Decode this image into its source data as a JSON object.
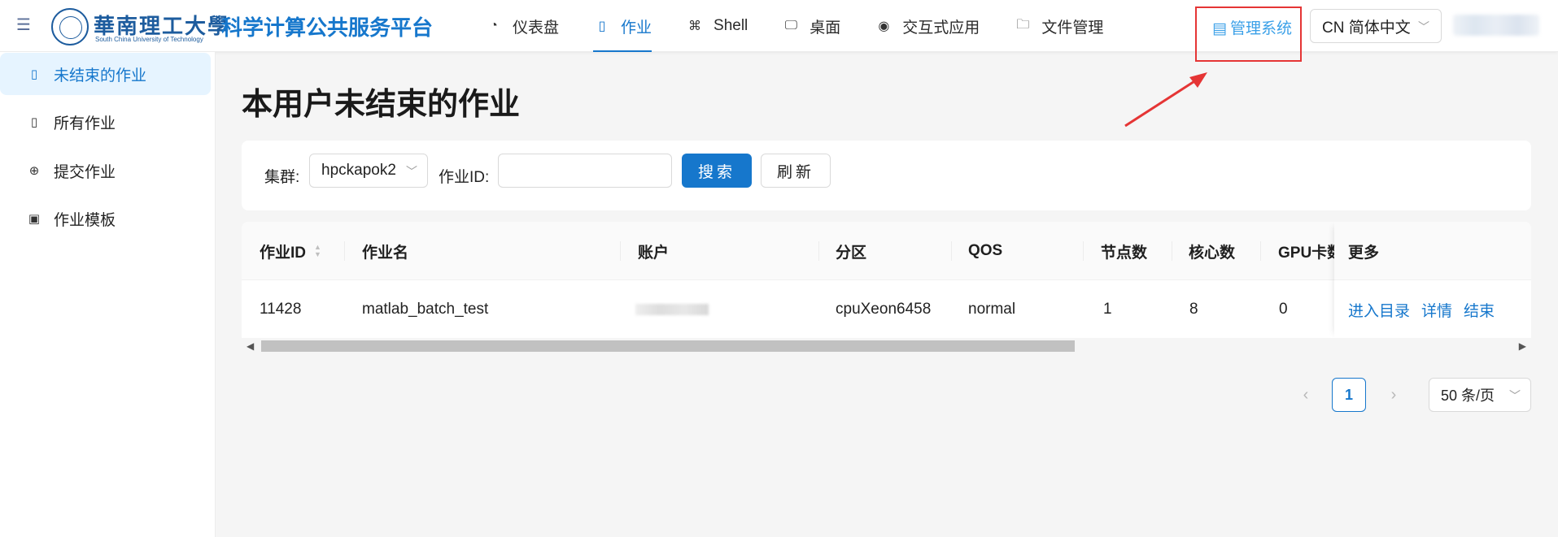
{
  "header": {
    "logo_cn": "華南理工大學",
    "logo_en": "South China University of Technology",
    "app_title": "科学计算公共服务平台",
    "nav": [
      {
        "icon": "dashboard-icon",
        "label": "仪表盘",
        "active": false
      },
      {
        "icon": "book-icon",
        "label": "作业",
        "active": true
      },
      {
        "icon": "shell-icon",
        "label": "Shell",
        "active": false
      },
      {
        "icon": "desktop-icon",
        "label": "桌面",
        "active": false
      },
      {
        "icon": "eye-icon",
        "label": "交互式应用",
        "active": false
      },
      {
        "icon": "folder-icon",
        "label": "文件管理",
        "active": false
      }
    ],
    "admin_link": "管理系统",
    "language": "CN 简体中文"
  },
  "sidebar": {
    "items": [
      {
        "icon": "book-icon",
        "label": "未结束的作业",
        "active": true
      },
      {
        "icon": "book-icon",
        "label": "所有作业",
        "active": false
      },
      {
        "icon": "plus-circle-icon",
        "label": "提交作业",
        "active": false
      },
      {
        "icon": "save-icon",
        "label": "作业模板",
        "active": false
      }
    ]
  },
  "main": {
    "title": "本用户未结束的作业",
    "filter": {
      "cluster_label": "集群:",
      "cluster_value": "hpckapok2",
      "jobid_label": "作业ID:",
      "jobid_value": "",
      "search_button": "搜索",
      "refresh_button": "刷新"
    },
    "table": {
      "columns": [
        "作业ID",
        "作业名",
        "账户",
        "分区",
        "QOS",
        "节点数",
        "核心数",
        "GPU卡数",
        "更多"
      ],
      "rows": [
        {
          "job_id": "11428",
          "job_name": "matlab_batch_test",
          "account": "",
          "partition": "cpuXeon6458",
          "qos": "normal",
          "nodes": "1",
          "cores": "8",
          "gpus": "0",
          "actions": [
            "进入目录",
            "详情",
            "结束"
          ]
        }
      ]
    },
    "pagination": {
      "current_page": "1",
      "page_size": "50 条/页"
    }
  },
  "colors": {
    "primary": "#1677cc",
    "admin_link": "#3aa0e8",
    "highlight": "#e53535",
    "sidebar_active_bg": "#e6f4ff"
  }
}
